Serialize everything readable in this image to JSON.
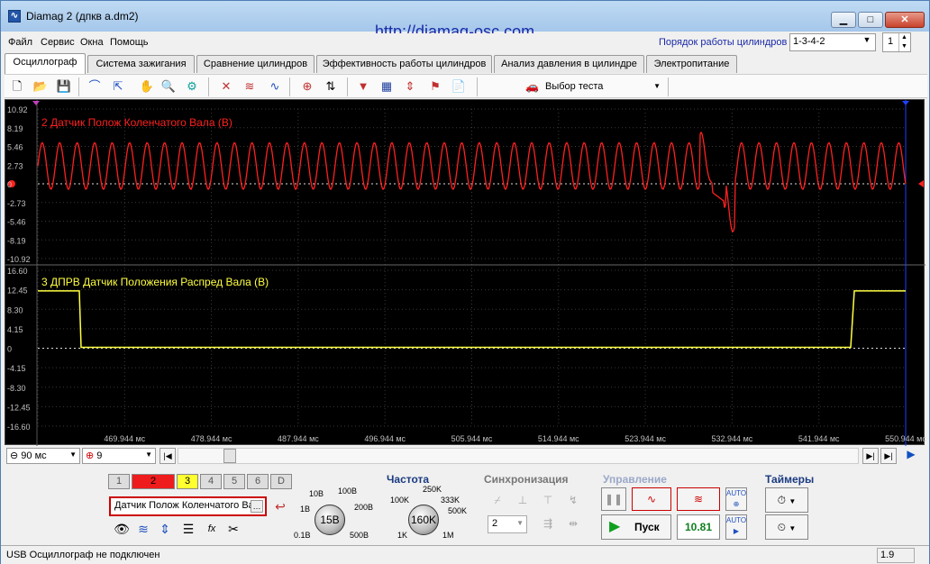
{
  "window": {
    "title": "Diamag 2 (дпкв а.dm2)",
    "url": "http://diamag-osc.com"
  },
  "menu": [
    "Файл",
    "Сервис",
    "Окна",
    "Помощь"
  ],
  "cylinders": {
    "label": "Порядок работы цилиндров",
    "order": "1-3-4-2",
    "spin": "1"
  },
  "tabs": [
    "Осциллограф",
    "Система зажигания",
    "Сравнение цилиндров",
    "Эффективность работы цилиндров",
    "Анализ давления в цилиндре",
    "Электропитание"
  ],
  "test_select": "Выбор теста",
  "channel2": {
    "title": "2 Датчик Полож Коленчатого Вала (В)",
    "color": "#ff2020",
    "ticks": [
      "10.92",
      "8.19",
      "5.46",
      "2.73",
      "0",
      "-2.73",
      "-5.46",
      "-8.19",
      "-10.92"
    ]
  },
  "channel3": {
    "title": "3 ДПРВ Датчик Положения Распред Вала (В)",
    "color": "#ffff40",
    "ticks": [
      "16.60",
      "12.45",
      "8.30",
      "4.15",
      "0",
      "-4.15",
      "-8.30",
      "-12.45",
      "-16.60"
    ]
  },
  "time_ticks": [
    "469.944 мс",
    "478.944 мс",
    "487.944 мс",
    "496.944 мс",
    "505.944 мс",
    "514.944 мс",
    "523.944 мс",
    "532.944 мс",
    "541.944 мс",
    "550.944 мс"
  ],
  "nav": {
    "timebase": "90 мс",
    "zoom": "9"
  },
  "channels_buttons": [
    "1",
    "2",
    "3",
    "4",
    "5",
    "6",
    "D"
  ],
  "channel_select": "Датчик Полож Коленчатого Ва",
  "voltage": {
    "ticks": [
      "10В",
      "100В",
      "1В",
      "200В",
      "0.1В",
      "500В"
    ],
    "value": "15В"
  },
  "freq": {
    "title": "Частота",
    "ticks": [
      "250K",
      "100K",
      "333K",
      "500K",
      "1K",
      "1M"
    ],
    "value": "160K"
  },
  "sync": {
    "title": "Синхронизация",
    "channel": "2"
  },
  "control": {
    "title": "Управление",
    "start": "Пуск",
    "rate": "10.81"
  },
  "timers": {
    "title": "Таймеры"
  },
  "status": {
    "text": "USB Осциллограф не подключен",
    "version": "1.9"
  }
}
